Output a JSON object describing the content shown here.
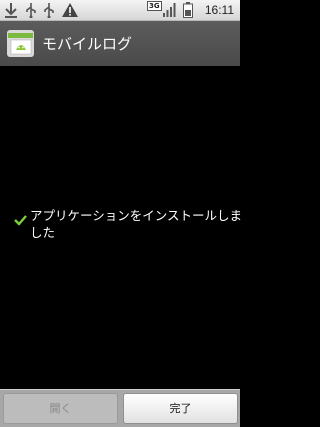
{
  "status_bar": {
    "network": "3G",
    "time": "16:11",
    "icons": [
      "download-icon",
      "usb-icon",
      "usb-icon",
      "warning-icon",
      "signal-icon",
      "battery-icon"
    ]
  },
  "title_bar": {
    "app_title": "モバイルログ",
    "app_icon": "android-app-icon"
  },
  "content": {
    "message": "アプリケーションをインストールしました",
    "check_color": "#7ccf3a"
  },
  "buttons": {
    "open_label": "開く",
    "done_label": "完了"
  }
}
